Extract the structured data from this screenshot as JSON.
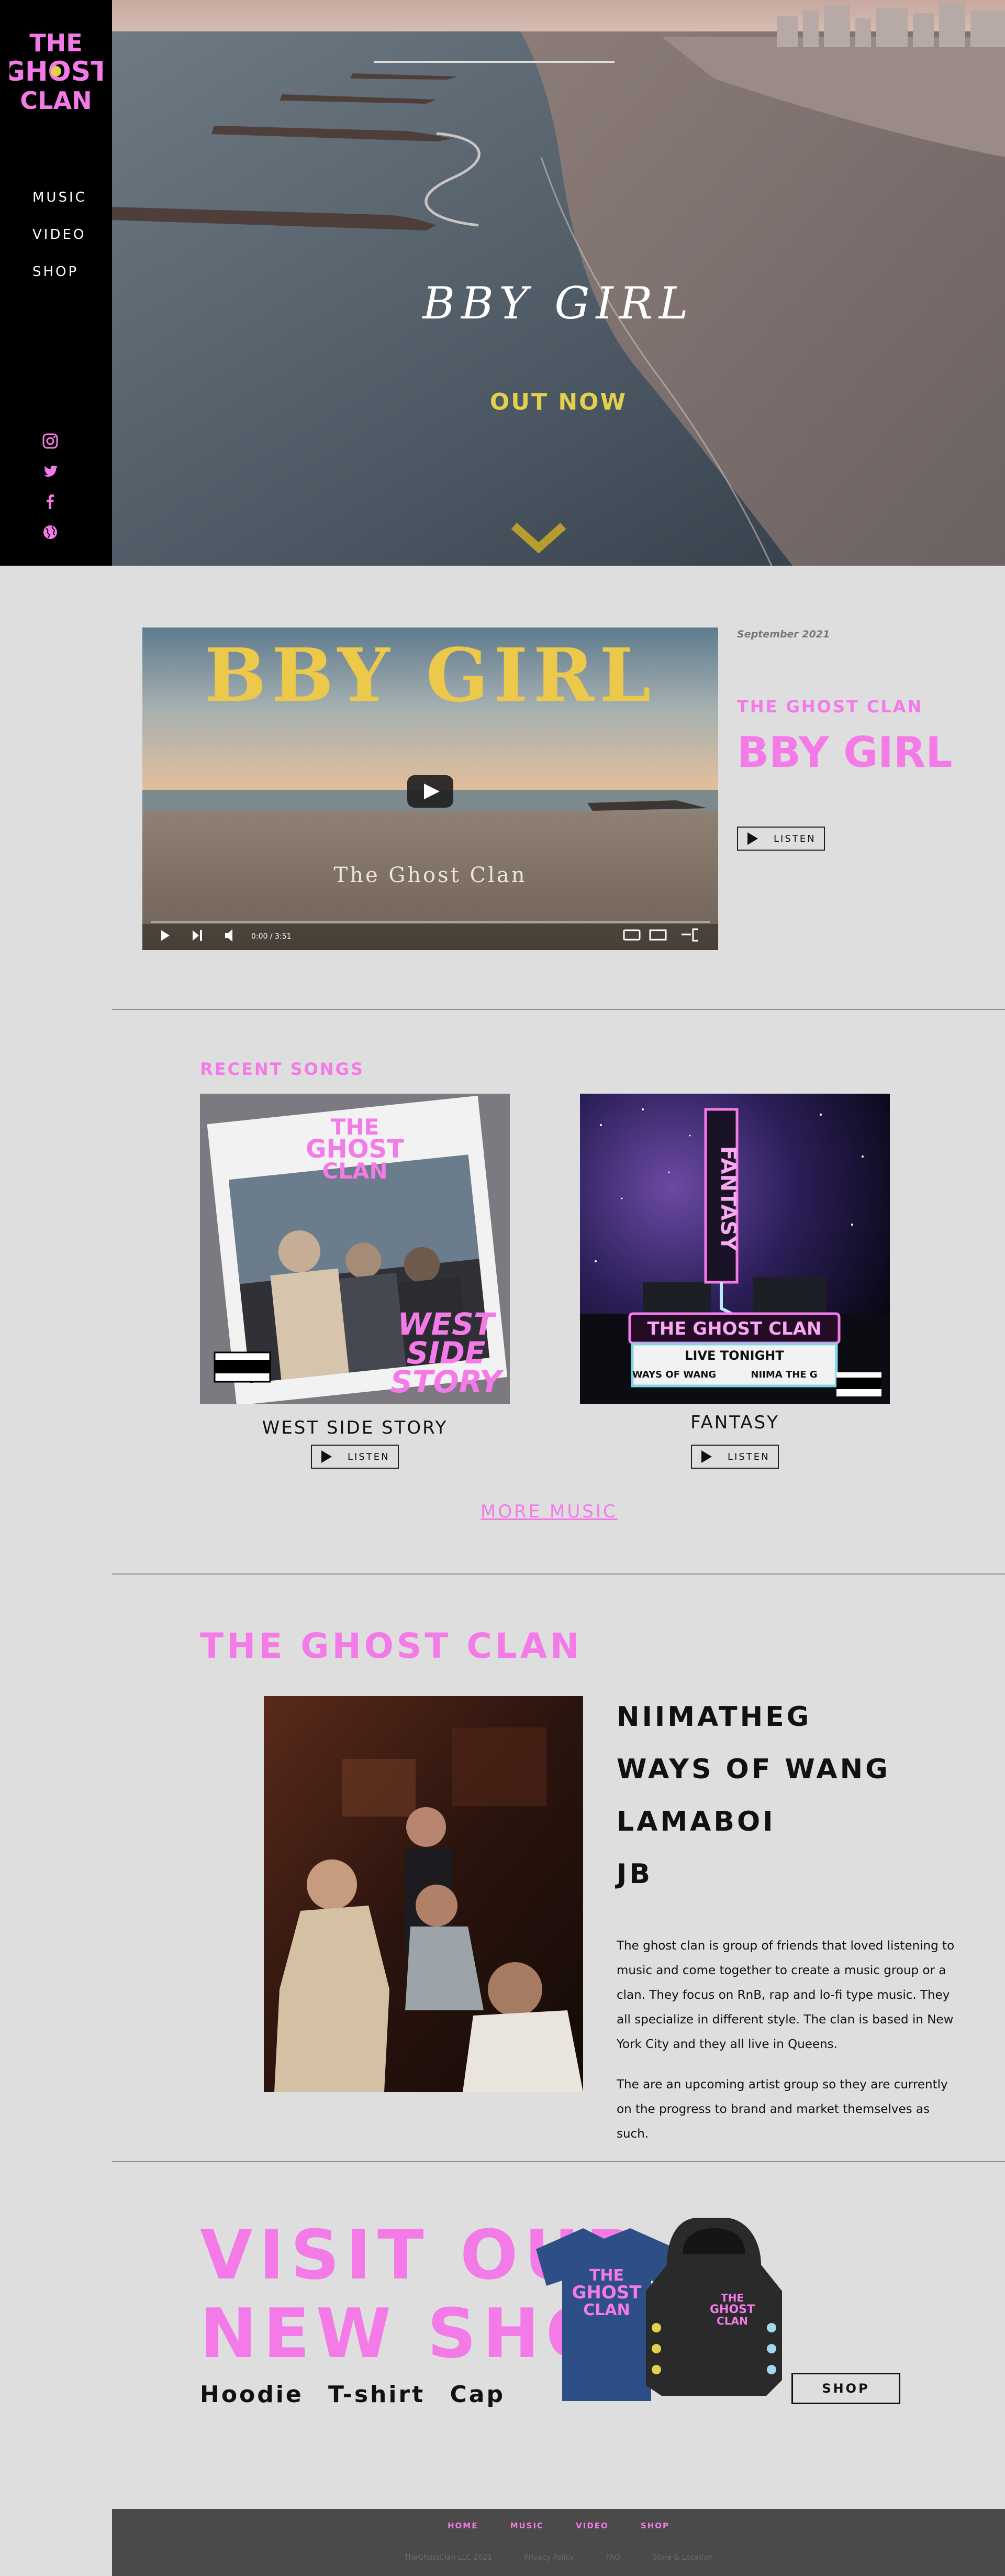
{
  "sidebar": {
    "logo_text": [
      "THE",
      "GHOST",
      "CLAN"
    ],
    "nav": [
      "MUSIC",
      "VIDEO",
      "SHOP"
    ],
    "social_icons": [
      "instagram-icon",
      "twitter-icon",
      "facebook-icon",
      "globe-icon"
    ]
  },
  "hero": {
    "title": "BBY GIRL",
    "subtitle": "OUT NOW"
  },
  "featured": {
    "video_title": "BBY GIRL",
    "video_caption": "The Ghost Clan",
    "video_time": "0:00 / 3:51",
    "date": "September 2021",
    "artist": "THE GHOST CLAN",
    "title": "BBY GIRL",
    "listen_label": "LISTEN"
  },
  "recent": {
    "label": "RECENT SONGS",
    "songs": [
      {
        "title": "WEST SIDE STORY",
        "listen_label": "LISTEN",
        "cover_text": [
          "WEST",
          "SIDE",
          "STORY"
        ]
      },
      {
        "title": "FANTASY",
        "listen_label": "LISTEN",
        "cover_text": [
          "FANTASY",
          "THE GHOST CLAN",
          "LIVE TONIGHT",
          "WAYS OF WANG",
          "NIIMA THE G"
        ]
      }
    ],
    "more_label": "MORE MUSIC"
  },
  "group": {
    "title": "THE GHOST CLAN",
    "members": [
      "NIIMATHEG",
      "WAYS OF WANG",
      "LAMABOI",
      "JB"
    ],
    "about": [
      "The ghost clan is group of friends that loved listening to music and come together to create a music group or a clan. They focus on RnB, rap and lo-fi type music. They all specialize in different style. The clan is based in New York City and they all live in Queens.",
      "The are an upcoming artist group so they are currently on the progress to brand and market themselves as such."
    ]
  },
  "shop": {
    "title_line1": "VISIT OUR",
    "title_line2": "NEW SHOP",
    "items": "Hoodie T-shirt Cap",
    "button": "SHOP"
  },
  "footer": {
    "nav": [
      "HOME",
      "MUSIC",
      "VIDEO",
      "SHOP"
    ],
    "links": [
      "TheGhostClan LLC 2021",
      "Privacy Policy",
      "FAQ",
      "Store & Location"
    ]
  },
  "colors": {
    "accent": "#f47ae8",
    "gold": "#e3d04d",
    "sidebar": "#000000",
    "footer": "#4a4a4a"
  }
}
